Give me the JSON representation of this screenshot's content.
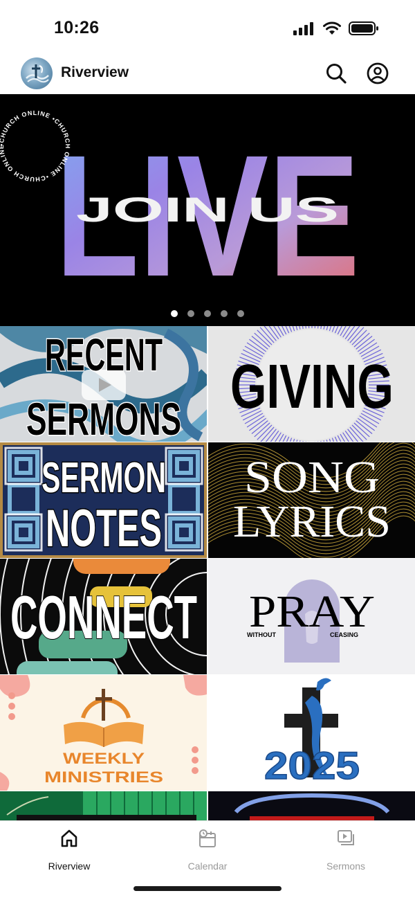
{
  "status_bar": {
    "time": "10:26"
  },
  "app_bar": {
    "title": "Riverview"
  },
  "hero": {
    "circle_text": "•CHURCH ONLINE •CHURCH ONLINE •CHURCH ONLINE ",
    "big_word": "LIVE",
    "overlay": "JOIN US",
    "dot_count": 5,
    "active_dot": 0
  },
  "tiles": [
    {
      "line1": "RECENT",
      "line2": "SERMONS"
    },
    {
      "line1": "GIVING"
    },
    {
      "line1": "SERMON",
      "line2": "NOTES"
    },
    {
      "line1": "SONG",
      "line2": "LYRICS"
    },
    {
      "line1": "CONNECT"
    },
    {
      "line1": "PRAY",
      "left": "WITHOUT",
      "right": "CEASING"
    },
    {
      "line1": "WEEKLY",
      "line2": "MINISTRIES"
    },
    {
      "line1": "2025"
    }
  ],
  "bottom_nav": {
    "items": [
      {
        "label": "Riverview",
        "icon": "home-icon",
        "active": true
      },
      {
        "label": "Calendar",
        "icon": "calendar-icon",
        "active": false
      },
      {
        "label": "Sermons",
        "icon": "video-library-icon",
        "active": false
      }
    ]
  },
  "colors": {
    "accent": "#111111",
    "inactive": "#9a9a9a",
    "hero_bg": "#000000",
    "weekly_orange": "#f0a046",
    "pray_blue": "#2a6fc0"
  }
}
